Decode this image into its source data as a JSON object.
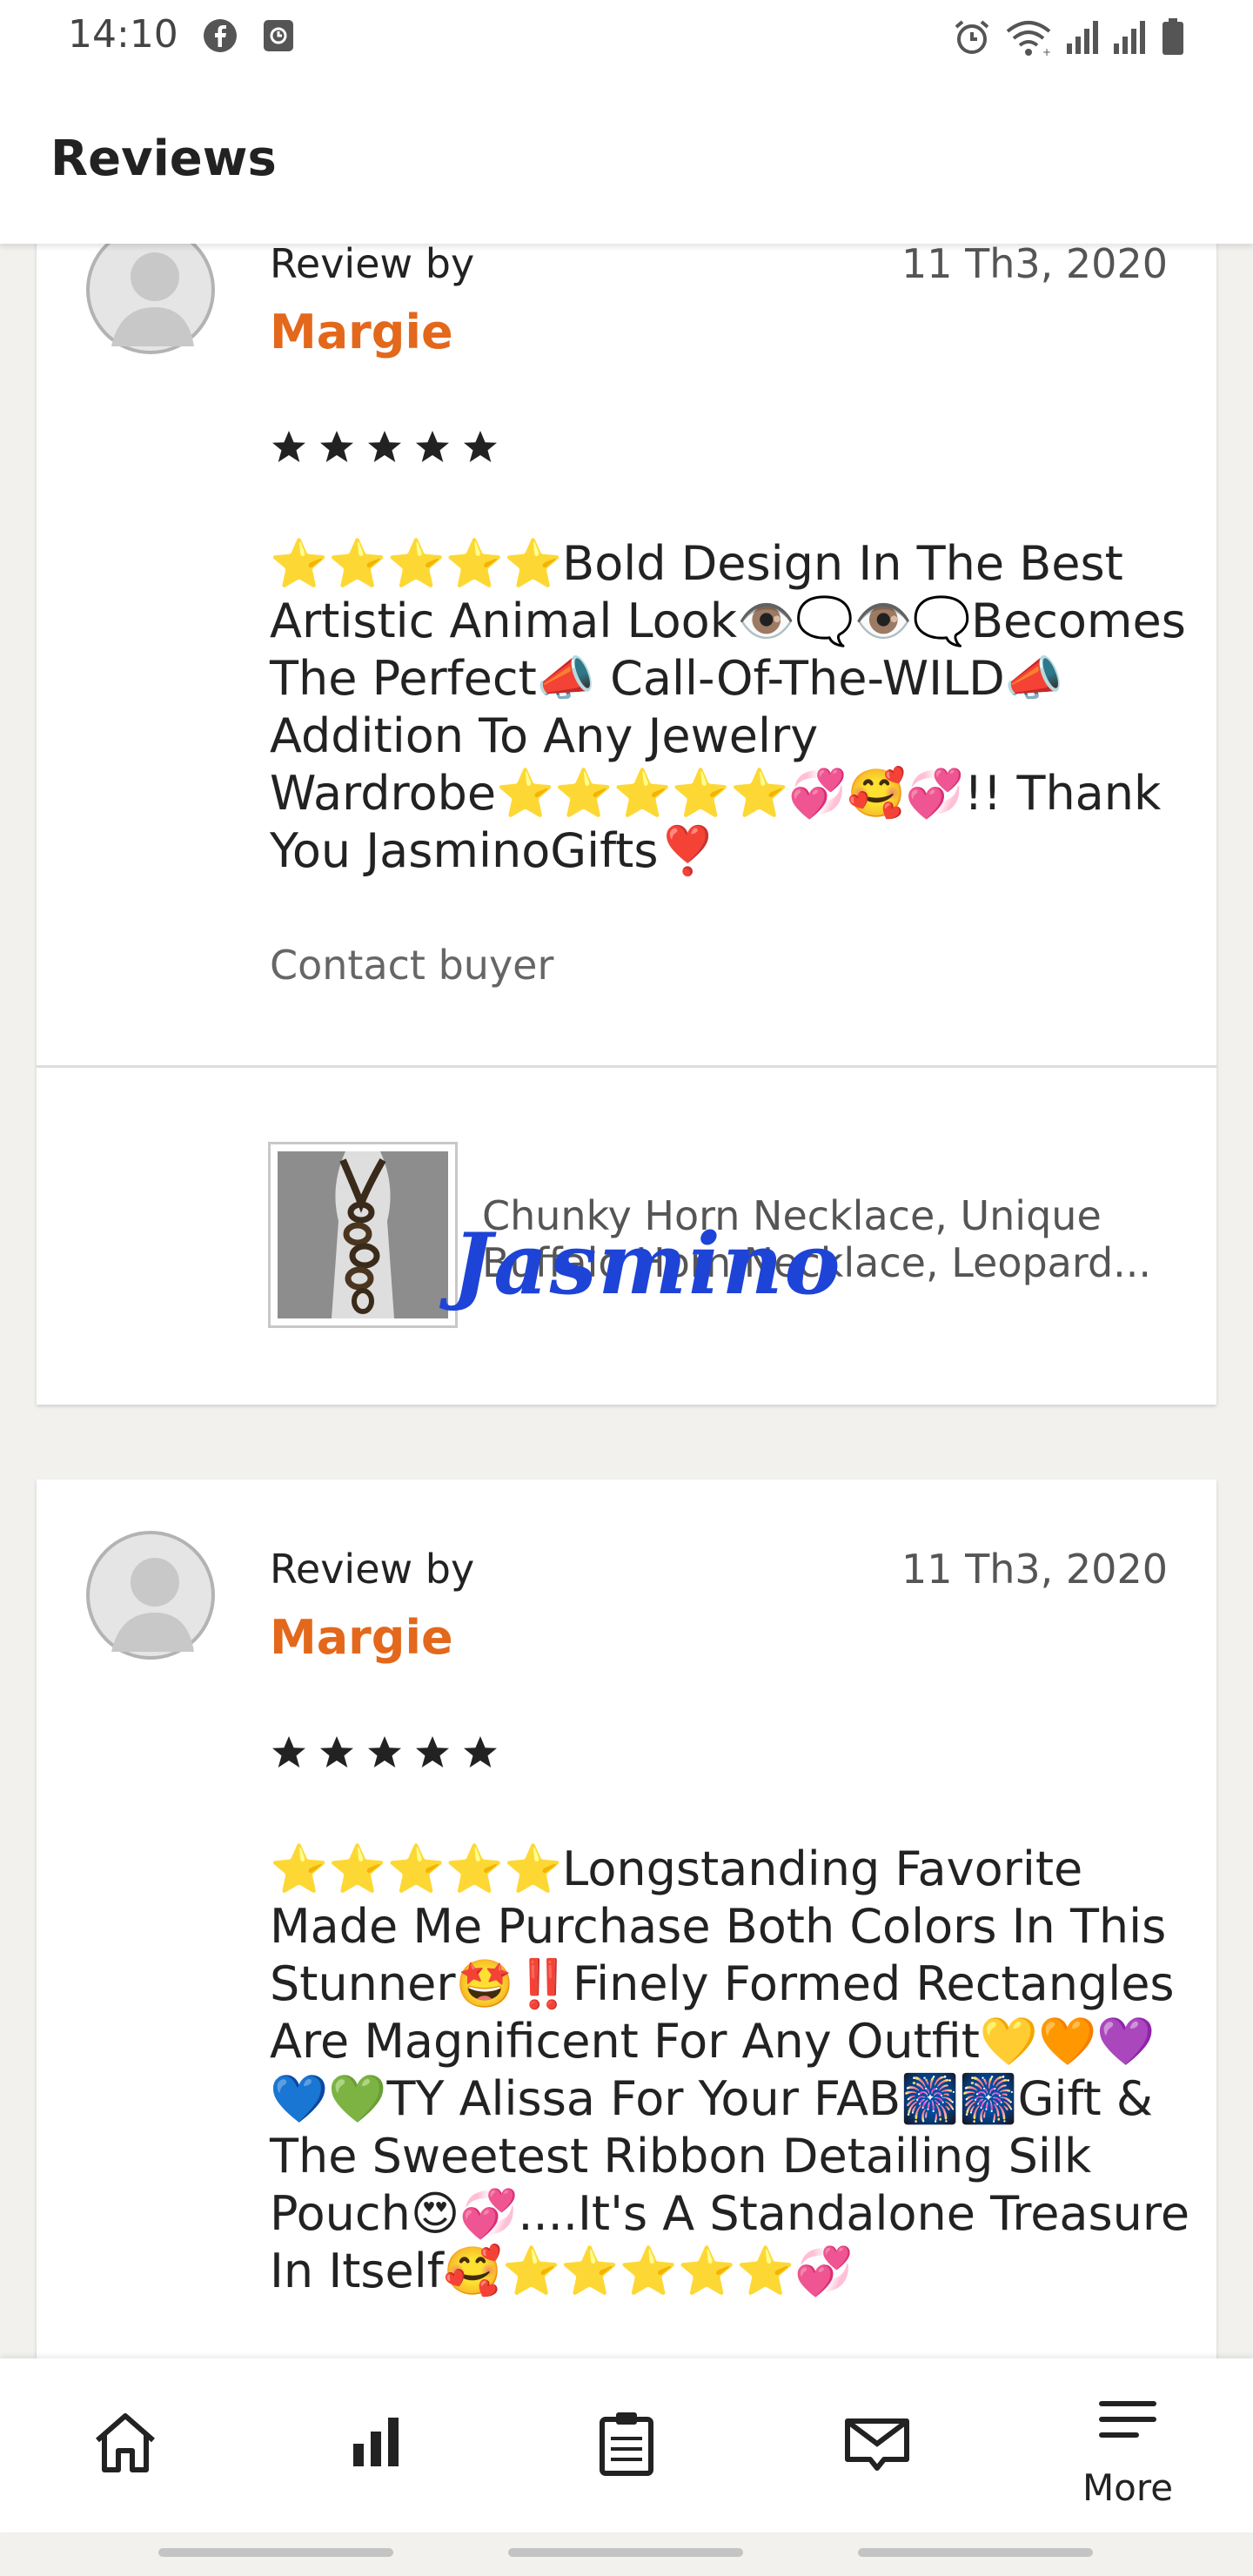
{
  "status_bar": {
    "time": "14:10",
    "icons_left": [
      "facebook-icon",
      "screen-icon"
    ],
    "icons_right": [
      "alarm-icon",
      "wifi-icon",
      "signal-icon",
      "signal-icon",
      "battery-icon"
    ]
  },
  "header": {
    "title": "Reviews"
  },
  "reviews": [
    {
      "review_by": "Review by",
      "reviewer": "Margie",
      "date": "11 Th3, 2020",
      "rating": 5,
      "text": "⭐⭐⭐⭐⭐Bold Design In The Best Artistic Animal Look👁️🗨️👁️🗨️Becomes The Perfect📣 Call-Of-The-WILD📣Addition To Any Jewelry Wardrobe⭐⭐⭐⭐⭐💞🥰💞!! Thank You JasminoGifts❣️",
      "contact": "Contact buyer",
      "listing_title": "Chunky Horn Necklace, Unique Buffalo Horn Necklace, Leopard...",
      "listing_line1": "Chunky Horn Necklace, Unique",
      "listing_line2": "Buffalo Horn Necklace, Leopard...",
      "watermark": "Jasmino"
    },
    {
      "review_by": "Review by",
      "reviewer": "Margie",
      "date": "11 Th3, 2020",
      "rating": 5,
      "text": "⭐⭐⭐⭐⭐Longstanding Favorite Made Me Purchase Both Colors In This Stunner🤩‼️Finely Formed Rectangles Are Magnificent For Any Outfit💛🧡💜💙💚TY Alissa For Your FAB🎆🎆Gift & The Sweetest Ribbon Detailing Silk Pouch😍💞....It's A Standalone Treasure In Itself🥰⭐⭐⭐⭐⭐💞"
    }
  ],
  "bottom_nav": [
    {
      "icon": "home-icon",
      "label": ""
    },
    {
      "icon": "stats-icon",
      "label": ""
    },
    {
      "icon": "orders-icon",
      "label": ""
    },
    {
      "icon": "messages-icon",
      "label": ""
    },
    {
      "icon": "menu-icon",
      "label": "More"
    }
  ],
  "colors": {
    "accent": "#e3681b",
    "background": "#f2f1ee",
    "watermark": "#1d44d6"
  }
}
